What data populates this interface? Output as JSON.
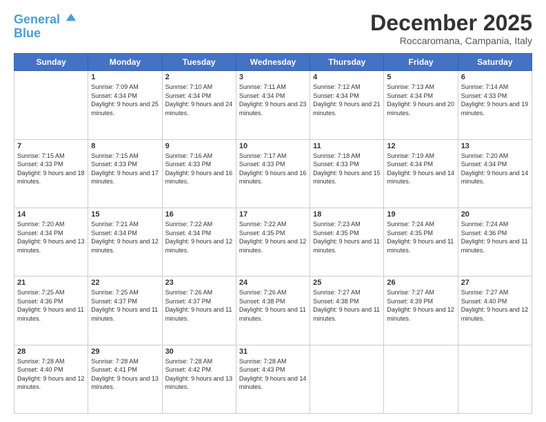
{
  "logo": {
    "line1": "General",
    "line2": "Blue"
  },
  "title": "December 2025",
  "subtitle": "Roccaromana, Campania, Italy",
  "days_of_week": [
    "Sunday",
    "Monday",
    "Tuesday",
    "Wednesday",
    "Thursday",
    "Friday",
    "Saturday"
  ],
  "weeks": [
    [
      {
        "day": "",
        "sunrise": "",
        "sunset": "",
        "daylight": ""
      },
      {
        "day": "1",
        "sunrise": "7:09 AM",
        "sunset": "4:34 PM",
        "daylight": "9 hours and 25 minutes."
      },
      {
        "day": "2",
        "sunrise": "7:10 AM",
        "sunset": "4:34 PM",
        "daylight": "9 hours and 24 minutes."
      },
      {
        "day": "3",
        "sunrise": "7:11 AM",
        "sunset": "4:34 PM",
        "daylight": "9 hours and 23 minutes."
      },
      {
        "day": "4",
        "sunrise": "7:12 AM",
        "sunset": "4:34 PM",
        "daylight": "9 hours and 21 minutes."
      },
      {
        "day": "5",
        "sunrise": "7:13 AM",
        "sunset": "4:34 PM",
        "daylight": "9 hours and 20 minutes."
      },
      {
        "day": "6",
        "sunrise": "7:14 AM",
        "sunset": "4:33 PM",
        "daylight": "9 hours and 19 minutes."
      }
    ],
    [
      {
        "day": "7",
        "sunrise": "7:15 AM",
        "sunset": "4:33 PM",
        "daylight": "9 hours and 18 minutes."
      },
      {
        "day": "8",
        "sunrise": "7:15 AM",
        "sunset": "4:33 PM",
        "daylight": "9 hours and 17 minutes."
      },
      {
        "day": "9",
        "sunrise": "7:16 AM",
        "sunset": "4:33 PM",
        "daylight": "9 hours and 16 minutes."
      },
      {
        "day": "10",
        "sunrise": "7:17 AM",
        "sunset": "4:33 PM",
        "daylight": "9 hours and 16 minutes."
      },
      {
        "day": "11",
        "sunrise": "7:18 AM",
        "sunset": "4:33 PM",
        "daylight": "9 hours and 15 minutes."
      },
      {
        "day": "12",
        "sunrise": "7:19 AM",
        "sunset": "4:34 PM",
        "daylight": "9 hours and 14 minutes."
      },
      {
        "day": "13",
        "sunrise": "7:20 AM",
        "sunset": "4:34 PM",
        "daylight": "9 hours and 14 minutes."
      }
    ],
    [
      {
        "day": "14",
        "sunrise": "7:20 AM",
        "sunset": "4:34 PM",
        "daylight": "9 hours and 13 minutes."
      },
      {
        "day": "15",
        "sunrise": "7:21 AM",
        "sunset": "4:34 PM",
        "daylight": "9 hours and 12 minutes."
      },
      {
        "day": "16",
        "sunrise": "7:22 AM",
        "sunset": "4:34 PM",
        "daylight": "9 hours and 12 minutes."
      },
      {
        "day": "17",
        "sunrise": "7:22 AM",
        "sunset": "4:35 PM",
        "daylight": "9 hours and 12 minutes."
      },
      {
        "day": "18",
        "sunrise": "7:23 AM",
        "sunset": "4:35 PM",
        "daylight": "9 hours and 11 minutes."
      },
      {
        "day": "19",
        "sunrise": "7:24 AM",
        "sunset": "4:35 PM",
        "daylight": "9 hours and 11 minutes."
      },
      {
        "day": "20",
        "sunrise": "7:24 AM",
        "sunset": "4:36 PM",
        "daylight": "9 hours and 11 minutes."
      }
    ],
    [
      {
        "day": "21",
        "sunrise": "7:25 AM",
        "sunset": "4:36 PM",
        "daylight": "9 hours and 11 minutes."
      },
      {
        "day": "22",
        "sunrise": "7:25 AM",
        "sunset": "4:37 PM",
        "daylight": "9 hours and 11 minutes."
      },
      {
        "day": "23",
        "sunrise": "7:26 AM",
        "sunset": "4:37 PM",
        "daylight": "9 hours and 11 minutes."
      },
      {
        "day": "24",
        "sunrise": "7:26 AM",
        "sunset": "4:38 PM",
        "daylight": "9 hours and 11 minutes."
      },
      {
        "day": "25",
        "sunrise": "7:27 AM",
        "sunset": "4:38 PM",
        "daylight": "9 hours and 11 minutes."
      },
      {
        "day": "26",
        "sunrise": "7:27 AM",
        "sunset": "4:39 PM",
        "daylight": "9 hours and 12 minutes."
      },
      {
        "day": "27",
        "sunrise": "7:27 AM",
        "sunset": "4:40 PM",
        "daylight": "9 hours and 12 minutes."
      }
    ],
    [
      {
        "day": "28",
        "sunrise": "7:28 AM",
        "sunset": "4:40 PM",
        "daylight": "9 hours and 12 minutes."
      },
      {
        "day": "29",
        "sunrise": "7:28 AM",
        "sunset": "4:41 PM",
        "daylight": "9 hours and 13 minutes."
      },
      {
        "day": "30",
        "sunrise": "7:28 AM",
        "sunset": "4:42 PM",
        "daylight": "9 hours and 13 minutes."
      },
      {
        "day": "31",
        "sunrise": "7:28 AM",
        "sunset": "4:43 PM",
        "daylight": "9 hours and 14 minutes."
      },
      {
        "day": "",
        "sunrise": "",
        "sunset": "",
        "daylight": ""
      },
      {
        "day": "",
        "sunrise": "",
        "sunset": "",
        "daylight": ""
      },
      {
        "day": "",
        "sunrise": "",
        "sunset": "",
        "daylight": ""
      }
    ]
  ]
}
